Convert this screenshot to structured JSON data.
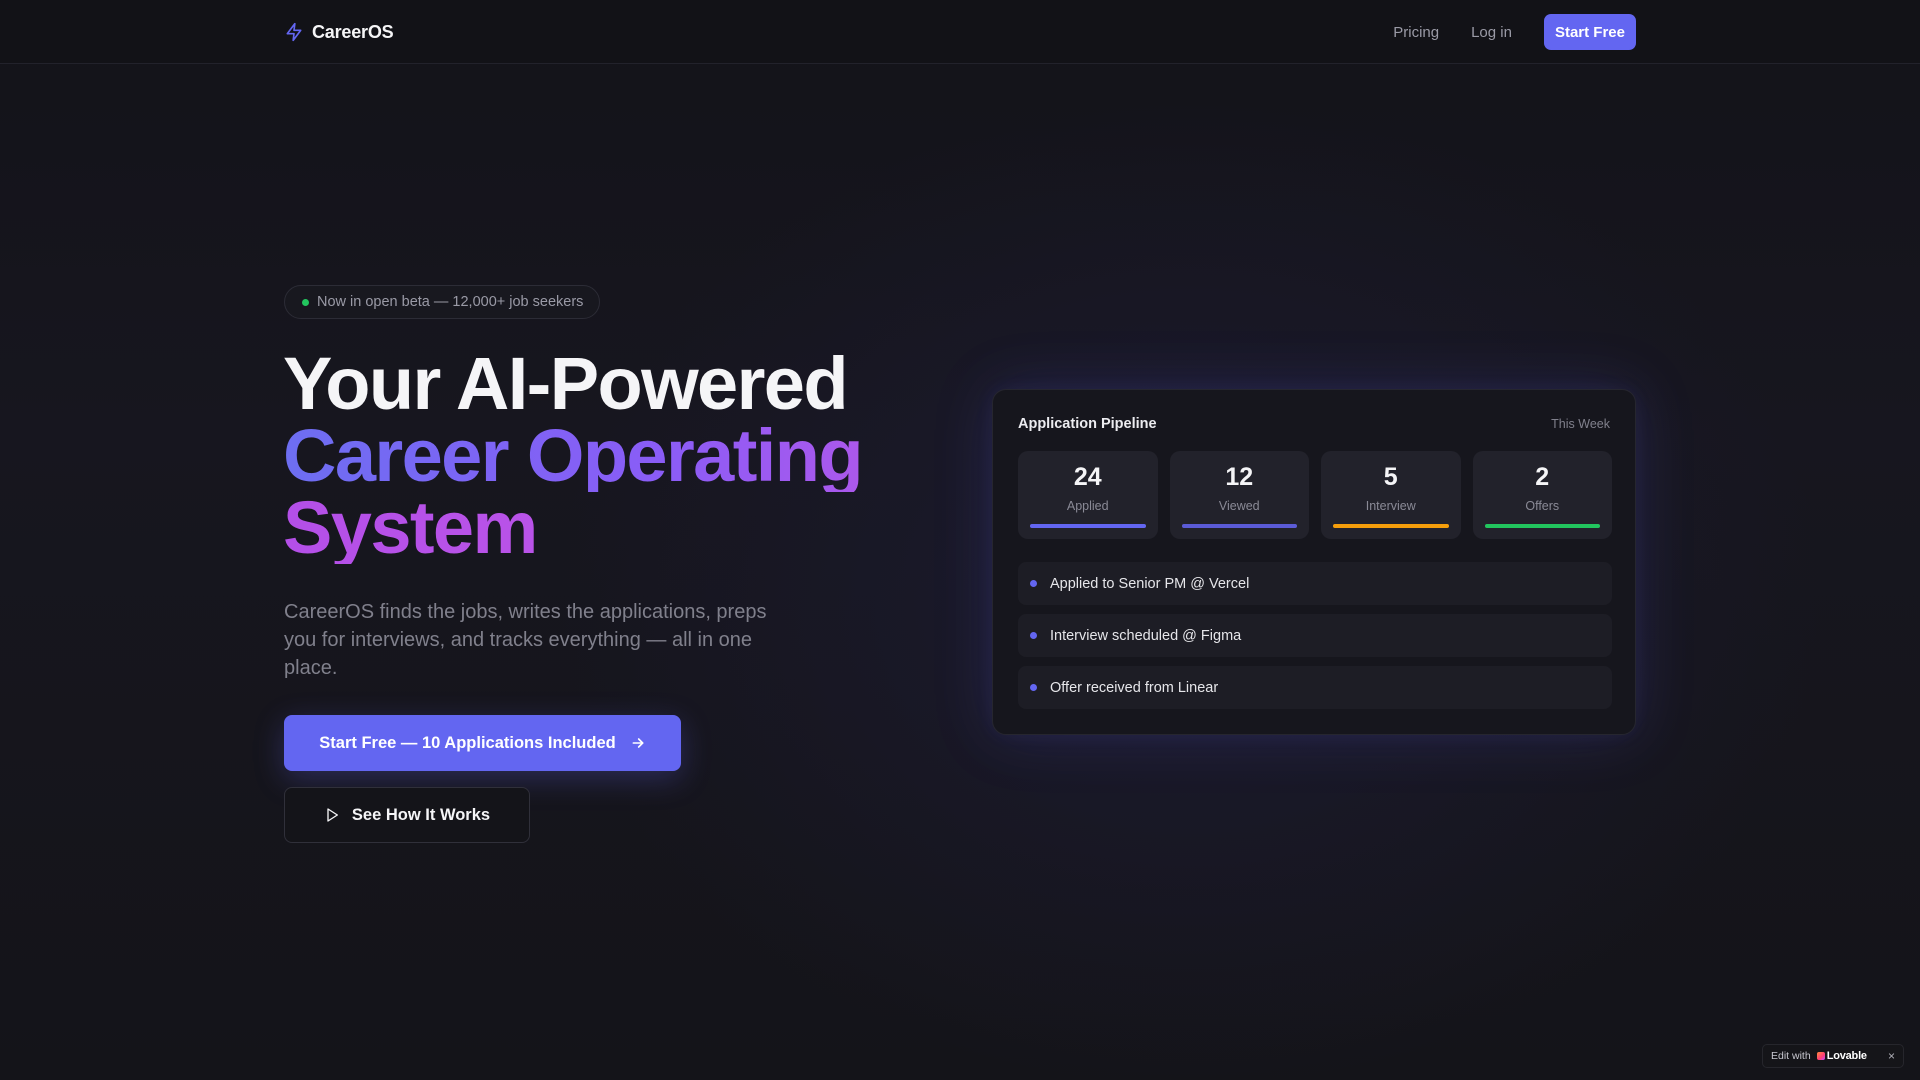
{
  "nav": {
    "brand": "CareerOS",
    "links": [
      "Pricing",
      "Log in"
    ],
    "cta": "Start Free"
  },
  "hero": {
    "badge": "Now in open beta — 12,000+ job seekers",
    "headline_line1": "Your AI-Powered",
    "headline_line2": "Career Operating",
    "headline_line3": "System",
    "subtext": "CareerOS finds the jobs, writes the applications, preps you for interviews, and tracks everything — all in one place.",
    "primary_cta": "Start Free — 10 Applications Included",
    "secondary_cta": "See How It Works"
  },
  "card": {
    "title": "Application Pipeline",
    "period": "This Week",
    "stats": [
      {
        "value": "24",
        "label": "Applied",
        "color": "#6366f1",
        "fill": 1.0
      },
      {
        "value": "12",
        "label": "Viewed",
        "color": "#5b5bd6",
        "fill": 1.0
      },
      {
        "value": "5",
        "label": "Interview",
        "color": "#f59e0b",
        "fill": 1.0
      },
      {
        "value": "2",
        "label": "Offers",
        "color": "#22c55e",
        "fill": 1.0
      }
    ],
    "activity": [
      "Applied to Senior PM @ Vercel",
      "Interview scheduled @ Figma",
      "Offer received from Linear"
    ]
  },
  "lovable_badge": {
    "prefix": "Edit with",
    "brand": "Lovable",
    "close": "×"
  },
  "colors": {
    "accent": "#6366f1",
    "gradient_start": "#6d6ef2",
    "gradient_end": "#c056e6",
    "status_green": "#22c55e",
    "status_amber": "#f59e0b"
  },
  "icons": {
    "brand": "lightning-bolt-icon",
    "primary_cta": "arrow-right-icon",
    "secondary_cta": "play-icon",
    "badge": "status-dot-icon"
  }
}
